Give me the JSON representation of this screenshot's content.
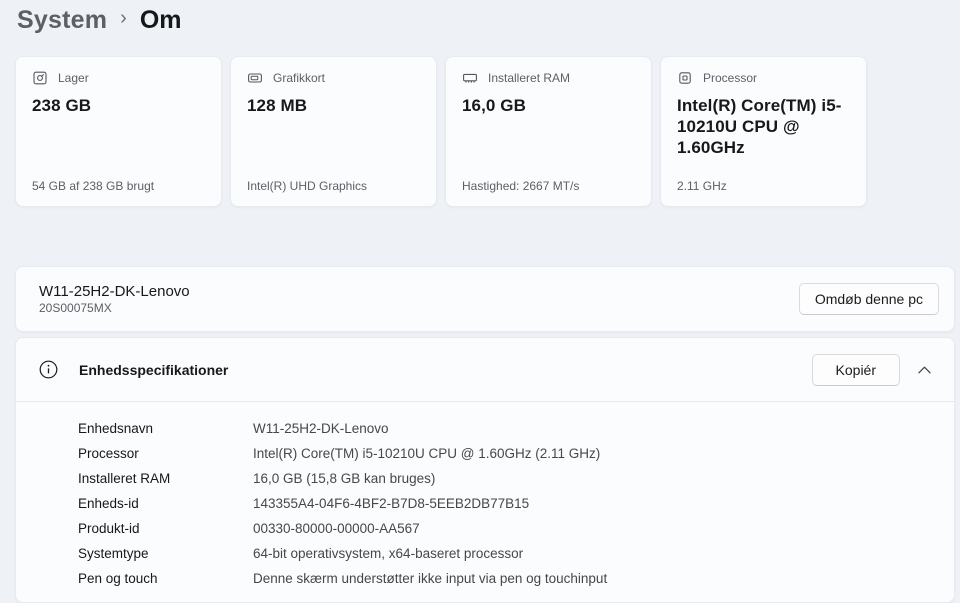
{
  "breadcrumb": {
    "parent": "System",
    "separator": "›",
    "current": "Om"
  },
  "cards": [
    {
      "icon": "storage-icon",
      "label": "Lager",
      "value": "238 GB",
      "detail": "54 GB af 238 GB brugt"
    },
    {
      "icon": "gpu-icon",
      "label": "Grafikkort",
      "value": "128 MB",
      "detail": "Intel(R) UHD Graphics"
    },
    {
      "icon": "ram-icon",
      "label": "Installeret RAM",
      "value": "16,0 GB",
      "detail": "Hastighed: 2667 MT/s"
    },
    {
      "icon": "cpu-icon",
      "label": "Processor",
      "value": "Intel(R) Core(TM) i5-10210U CPU @ 1.60GHz",
      "detail": "2.11 GHz"
    }
  ],
  "device": {
    "name": "W11-25H2-DK-Lenovo",
    "model": "20S00075MX",
    "rename_button": "Omdøb denne pc"
  },
  "specs": {
    "title": "Enhedsspecifikationer",
    "copy_button": "Kopiér",
    "rows": [
      {
        "label": "Enhedsnavn",
        "value": "W11-25H2-DK-Lenovo"
      },
      {
        "label": "Processor",
        "value": "Intel(R) Core(TM) i5-10210U CPU @ 1.60GHz (2.11 GHz)"
      },
      {
        "label": "Installeret RAM",
        "value": "16,0 GB (15,8 GB kan bruges)"
      },
      {
        "label": "Enheds-id",
        "value": "143355A4-04F6-4BF2-B7D8-5EEB2DB77B15"
      },
      {
        "label": "Produkt-id",
        "value": "00330-80000-00000-AA567"
      },
      {
        "label": "Systemtype",
        "value": "64-bit operativsystem, x64-baseret processor"
      },
      {
        "label": "Pen og touch",
        "value": "Denne skærm understøtter ikke input via pen og touchinput"
      }
    ]
  }
}
